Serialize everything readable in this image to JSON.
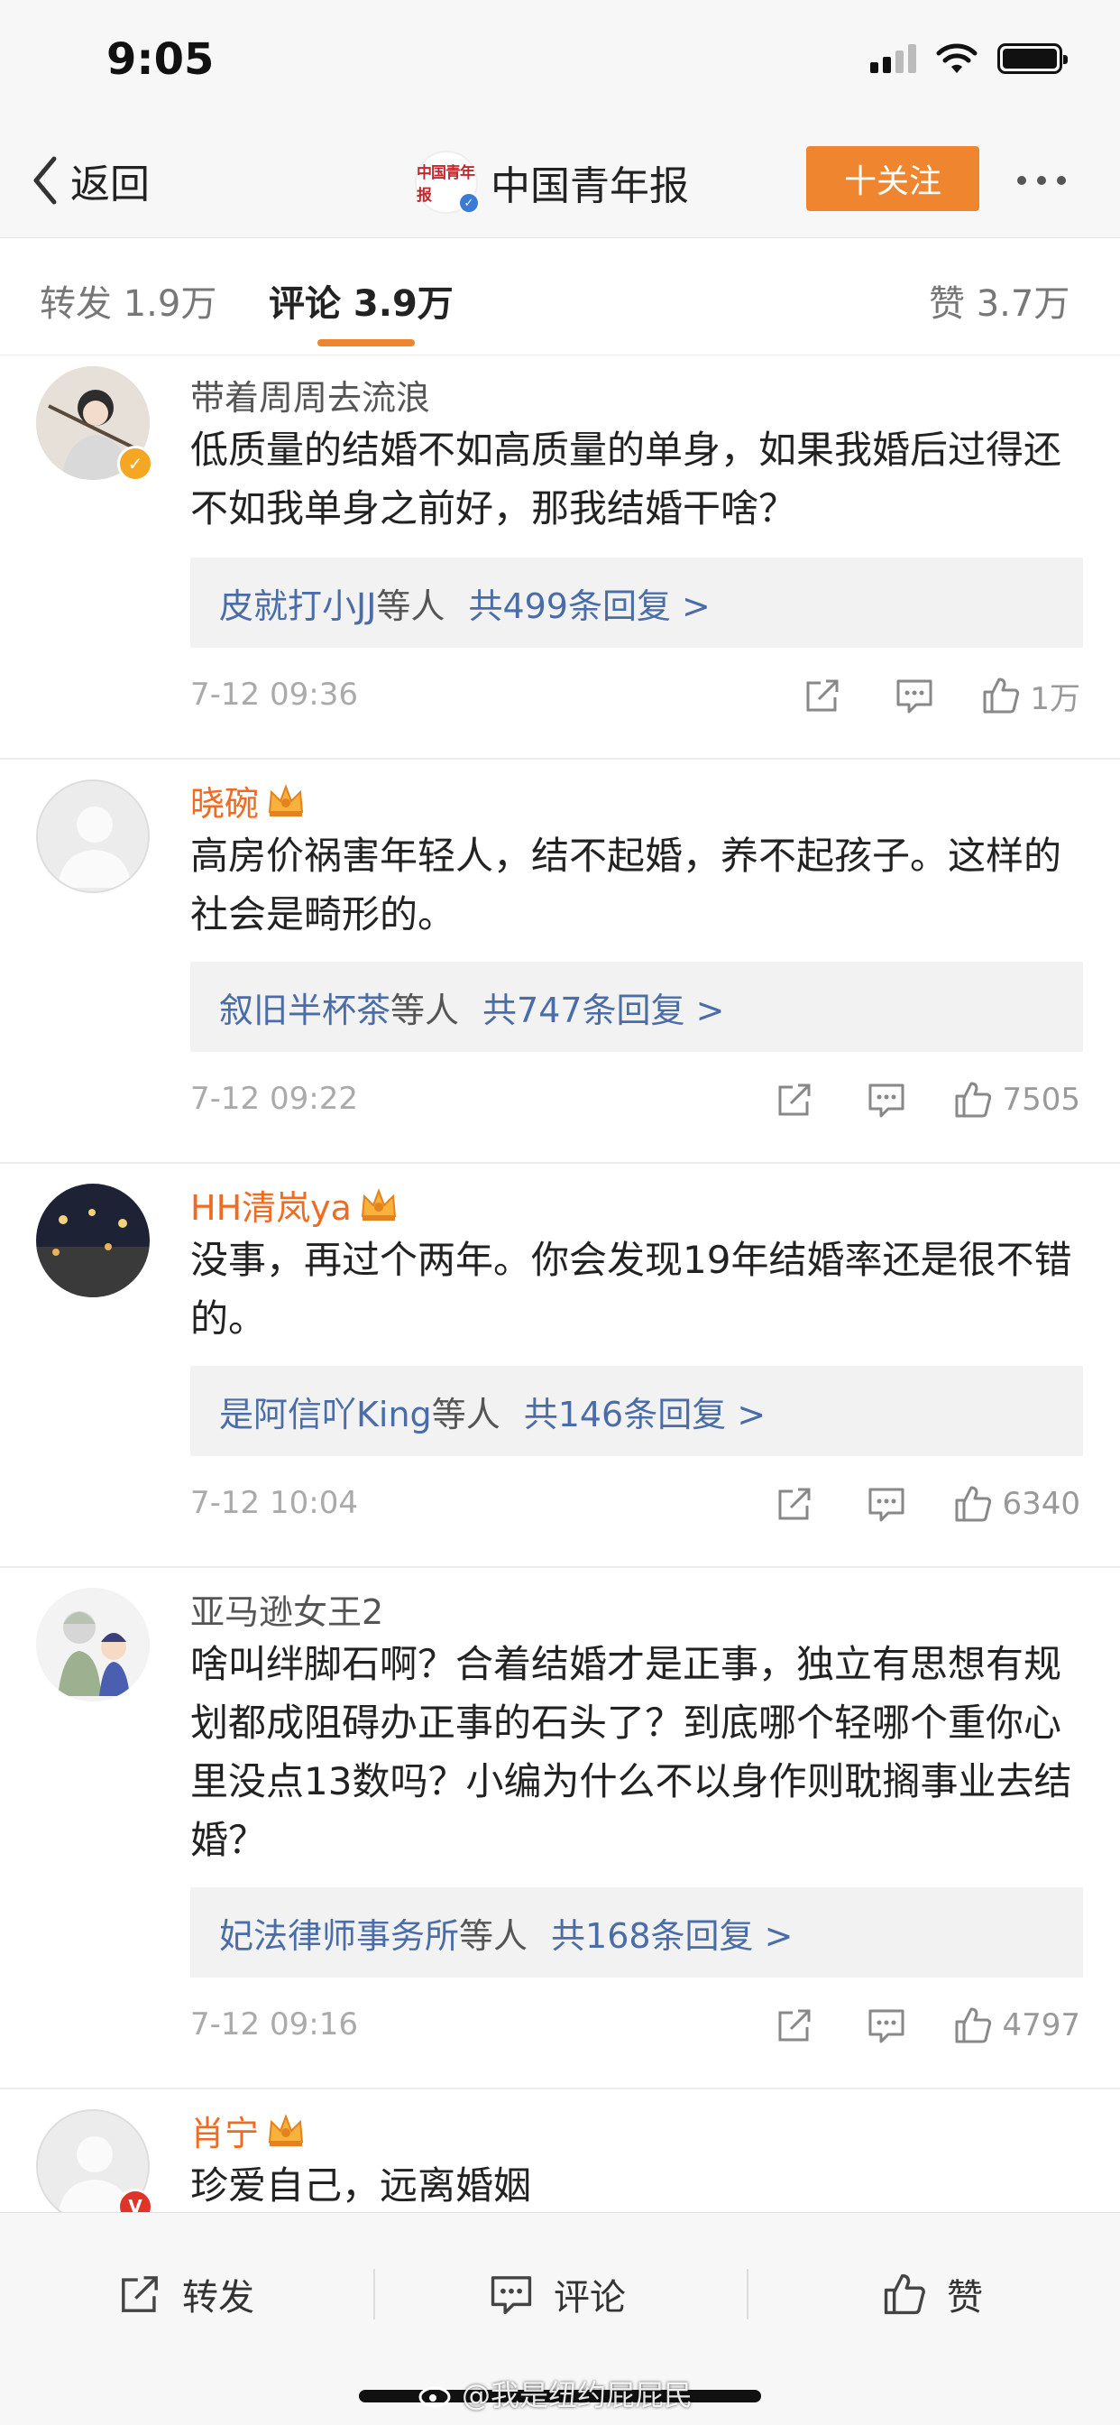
{
  "status_bar": {
    "time": "9:05"
  },
  "nav": {
    "back_label": "返回",
    "title": "中国青年报",
    "logo_text": "中国青年报",
    "follow_label": "十关注"
  },
  "tabs": {
    "repost": "转发 1.9万",
    "comments": "评论 3.9万",
    "likes": "赞 3.7万"
  },
  "comments": [
    {
      "name": "带着周周去流浪",
      "text": "低质量的结婚不如高质量的单身，如果我婚后过得还不如我单身之前好，那我结婚干啥？",
      "reply_users": "皮就打小JJ等人",
      "reply_total": "共499条回复 >",
      "time": "7-12 09:36",
      "likes": "1万"
    },
    {
      "name": "晓碗",
      "text": "高房价祸害年轻人，结不起婚，养不起孩子。这样的社会是畸形的。",
      "reply_users": "叙旧半杯茶等人",
      "reply_total": "共747条回复 >",
      "time": "7-12 09:22",
      "likes": "7505"
    },
    {
      "name": "HH清岚ya",
      "text": "没事，再过个两年。你会发现19年结婚率还是很不错的。",
      "reply_users": "是阿信吖King等人",
      "reply_total": "共146条回复 >",
      "time": "7-12 10:04",
      "likes": "6340"
    },
    {
      "name": "亚马逊女王2",
      "text": "啥叫绊脚石啊？合着结婚才是正事，独立有思想有规划都成阻碍办正事的石头了？到底哪个轻哪个重你心里没点13数吗？小编为什么不以身作则耽搁事业去结婚？",
      "reply_users": "妃法律师事务所等人",
      "reply_total": "共168条回复 >",
      "time": "7-12 09:16",
      "likes": "4797"
    },
    {
      "name": "肖宁",
      "text": "珍爱自己，远离婚姻"
    }
  ],
  "bottom_bar": {
    "repost": "转发",
    "comment": "评论",
    "like": "赞"
  },
  "watermark": "@我是纽约屁屁民",
  "colors": {
    "accent_orange": "#f08530",
    "vip_name": "#f06b22",
    "reply_link": "#4a6da7",
    "verified_yellow": "#f5a623",
    "verified_red": "#e0342a"
  }
}
